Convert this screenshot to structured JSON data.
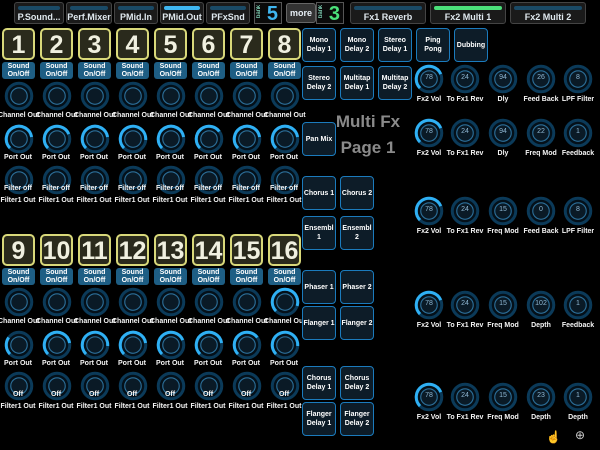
{
  "tabs": [
    {
      "label": "P.Sound..."
    },
    {
      "label": "Perf.Mixer"
    },
    {
      "label": "PMid.In"
    },
    {
      "label": "PMid.Out"
    },
    {
      "label": "PFxSnd"
    }
  ],
  "bank_left": {
    "label": "bank",
    "value": "5"
  },
  "more_label": "more",
  "bank_right": {
    "label": "bank",
    "value": "3"
  },
  "fx_tabs": [
    {
      "label": "Fx1 Reverb"
    },
    {
      "label": "Fx2 Multi 1"
    },
    {
      "label": "Fx2 Multi 2"
    }
  ],
  "channels_top": [
    "1",
    "2",
    "3",
    "4",
    "5",
    "6",
    "7",
    "8"
  ],
  "channels_bottom": [
    "9",
    "10",
    "11",
    "12",
    "13",
    "14",
    "15",
    "16"
  ],
  "sound_label": "Sound On/Off",
  "sound_line1": "Sound",
  "sound_line2": "On/Off",
  "row_labels": {
    "channel_out": "Channel Out",
    "port_out": "Port Out",
    "filter_off": "Filter off",
    "filter1_out": "Filter1 Out",
    "off": "Off"
  },
  "page_title": {
    "line1": "Multi Fx",
    "line2": "Page 1"
  },
  "fx_buttons": [
    [
      "Mono Delay 1",
      "Mono Delay 2",
      "Stereo Delay 1",
      "Ping Pong",
      "Dubbing"
    ],
    [
      "Stereo Delay 2",
      "Multitap Delay 1",
      "Multitap Delay 2"
    ],
    [
      "Pan Mix"
    ],
    [
      "Chorus 1",
      "Chorus 2"
    ],
    [
      "Ensembl 1",
      "Ensembl 2"
    ],
    [
      "Phaser 1",
      "Phaser 2"
    ],
    [
      "Flanger 1",
      "Flanger 2"
    ],
    [
      "Chorus Delay 1",
      "Chorus Delay 2"
    ],
    [
      "Flanger Delay 1",
      "Flanger Delay 2"
    ]
  ],
  "right_rows": [
    {
      "labels": [
        "Fx2 Vol",
        "To Fx1 Rev",
        "Dly",
        "Feed Back",
        "LPF Filter"
      ],
      "values": [
        "78",
        "24",
        "94",
        "26",
        "8"
      ]
    },
    {
      "labels": [
        "Fx2 Vol",
        "To Fx1 Rev",
        "Dly",
        "Freq Mod",
        "Feedback"
      ],
      "values": [
        "78",
        "24",
        "94",
        "22",
        "1"
      ]
    },
    {
      "labels": [
        "Fx2 Vol",
        "To Fx1 Rev",
        "Freq Mod",
        "Feed Back",
        "LPF Filter"
      ],
      "values": [
        "78",
        "24",
        "15",
        "0",
        "8"
      ]
    },
    {
      "labels": [
        "Fx2 Vol",
        "To Fx1 Rev",
        "Freq Mod",
        "Depth",
        "Feedback"
      ],
      "values": [
        "78",
        "24",
        "15",
        "102",
        "1"
      ]
    },
    {
      "labels": [
        "Fx2 Vol",
        "To Fx1 Rev",
        "Freq Mod",
        "Depth",
        "Depth"
      ],
      "values": [
        "78",
        "24",
        "15",
        "23",
        "1"
      ]
    }
  ],
  "colors": {
    "accent": "#3fb6f0",
    "panel": "#1e5e84",
    "highlight": "#d8d87a"
  }
}
